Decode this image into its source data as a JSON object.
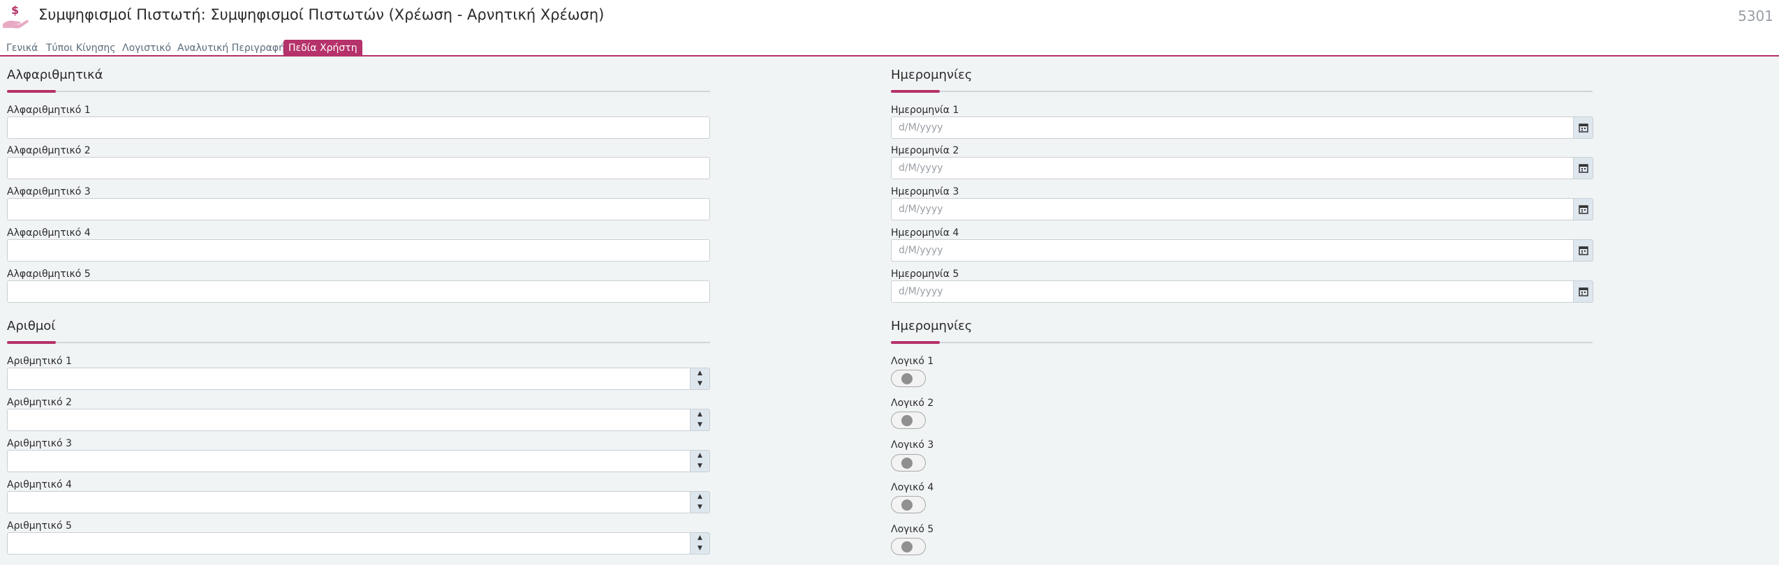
{
  "header": {
    "title": "Συμψηφισμοί Πιστωτή: Συμψηφισμοί Πιστωτών (Χρέωση - Αρνητική Χρέωση)",
    "record_id": "5301",
    "icon": "hand-money-icon"
  },
  "tabs": [
    {
      "label": "Γενικά",
      "active": false
    },
    {
      "label": "Τύποι Κίνησης",
      "active": false
    },
    {
      "label": "Λογιστικό",
      "active": false
    },
    {
      "label": "Αναλυτική Περιγραφή",
      "active": false
    },
    {
      "label": "Πεδία Χρήστη",
      "active": true
    }
  ],
  "alphanumeric": {
    "title": "Αλφαριθμητικά",
    "fields": [
      {
        "label": "Αλφαριθμητικό 1",
        "value": ""
      },
      {
        "label": "Αλφαριθμητικό 2",
        "value": ""
      },
      {
        "label": "Αλφαριθμητικό 3",
        "value": ""
      },
      {
        "label": "Αλφαριθμητικό 4",
        "value": ""
      },
      {
        "label": "Αλφαριθμητικό 5",
        "value": ""
      }
    ]
  },
  "dates": {
    "title": "Ημερομηνίες",
    "placeholder": "d/M/yyyy",
    "fields": [
      {
        "label": "Ημερομηνία 1",
        "value": ""
      },
      {
        "label": "Ημερομηνία 2",
        "value": ""
      },
      {
        "label": "Ημερομηνία 3",
        "value": ""
      },
      {
        "label": "Ημερομηνία 4",
        "value": ""
      },
      {
        "label": "Ημερομηνία 5",
        "value": ""
      }
    ]
  },
  "numbers": {
    "title": "Αριθμοί",
    "fields": [
      {
        "label": "Αριθμητικό 1",
        "value": ""
      },
      {
        "label": "Αριθμητικό 2",
        "value": ""
      },
      {
        "label": "Αριθμητικό 3",
        "value": ""
      },
      {
        "label": "Αριθμητικό 4",
        "value": ""
      },
      {
        "label": "Αριθμητικό 5",
        "value": ""
      }
    ]
  },
  "logicals": {
    "title": "Ημερομηνίες",
    "fields": [
      {
        "label": "Λογικό 1",
        "checked": false
      },
      {
        "label": "Λογικό 2",
        "checked": false
      },
      {
        "label": "Λογικό 3",
        "checked": false
      },
      {
        "label": "Λογικό 4",
        "checked": false
      },
      {
        "label": "Λογικό 5",
        "checked": false
      }
    ]
  },
  "colors": {
    "accent": "#b5326a"
  }
}
